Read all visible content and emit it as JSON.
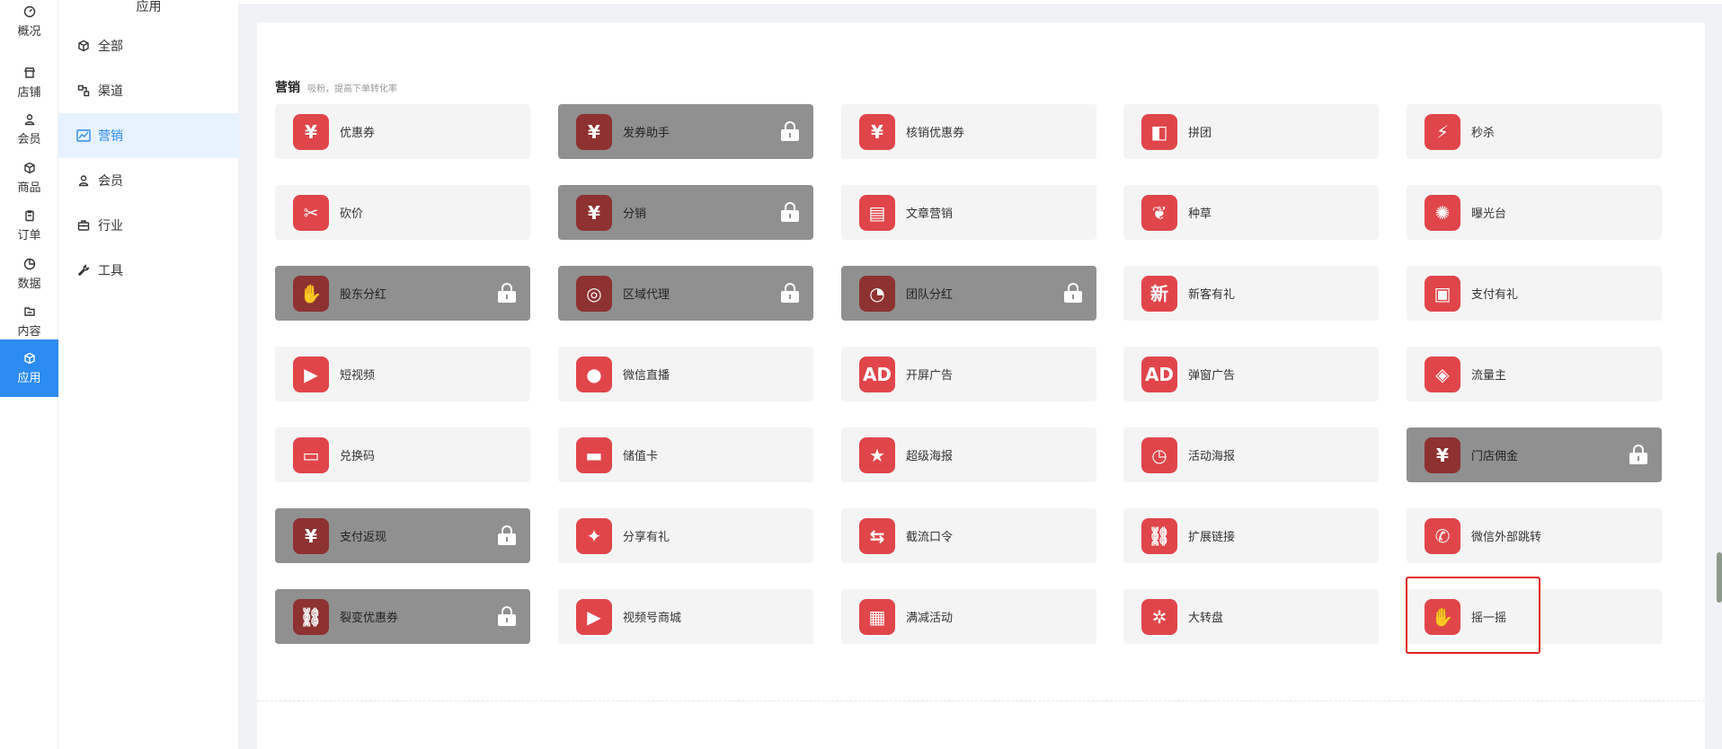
{
  "rail": [
    {
      "label": "概况",
      "icon": "dashboard-icon"
    },
    {
      "label": "店铺",
      "icon": "store-icon"
    },
    {
      "label": "会员",
      "icon": "user-icon"
    },
    {
      "label": "商品",
      "icon": "box-icon"
    },
    {
      "label": "订单",
      "icon": "clipboard-icon"
    },
    {
      "label": "数据",
      "icon": "pie-icon"
    },
    {
      "label": "内容",
      "icon": "folder-icon"
    },
    {
      "label": "应用",
      "icon": "app-icon",
      "active": true
    }
  ],
  "submenu": {
    "title": "应用",
    "items": [
      {
        "label": "全部",
        "icon": "cube-icon"
      },
      {
        "label": "渠道",
        "icon": "channel-icon"
      },
      {
        "label": "营销",
        "icon": "chart-line-icon",
        "active": true
      },
      {
        "label": "会员",
        "icon": "user-icon"
      },
      {
        "label": "行业",
        "icon": "briefcase-icon"
      },
      {
        "label": "工具",
        "icon": "wrench-icon"
      }
    ]
  },
  "section": {
    "title": "营销",
    "subtitle": "吸粉，提高下单转化率"
  },
  "apps": [
    {
      "label": "优惠券",
      "glyph": "¥",
      "icon": "coupon-icon",
      "locked": false
    },
    {
      "label": "发券助手",
      "glyph": "¥",
      "icon": "coupon-helper-icon",
      "locked": true
    },
    {
      "label": "核销优惠券",
      "glyph": "¥",
      "icon": "verify-coupon-icon",
      "locked": false
    },
    {
      "label": "拼团",
      "glyph": "◧",
      "icon": "group-buy-icon",
      "locked": false
    },
    {
      "label": "秒杀",
      "glyph": "⚡",
      "icon": "flash-sale-icon",
      "locked": false
    },
    {
      "label": "砍价",
      "glyph": "✂",
      "icon": "bargain-icon",
      "locked": false
    },
    {
      "label": "分销",
      "glyph": "¥",
      "icon": "distribution-icon",
      "locked": true
    },
    {
      "label": "文章营销",
      "glyph": "▤",
      "icon": "article-icon",
      "locked": false
    },
    {
      "label": "种草",
      "glyph": "❦",
      "icon": "sprout-icon",
      "locked": false
    },
    {
      "label": "曝光台",
      "glyph": "✺",
      "icon": "exposure-icon",
      "locked": false
    },
    {
      "label": "股东分红",
      "glyph": "✋",
      "icon": "shareholder-icon",
      "locked": true
    },
    {
      "label": "区域代理",
      "glyph": "◎",
      "icon": "region-agent-icon",
      "locked": true
    },
    {
      "label": "团队分红",
      "glyph": "◔",
      "icon": "team-dividend-icon",
      "locked": true
    },
    {
      "label": "新客有礼",
      "glyph": "新",
      "icon": "new-customer-icon",
      "locked": false
    },
    {
      "label": "支付有礼",
      "glyph": "▣",
      "icon": "gift-icon",
      "locked": false
    },
    {
      "label": "短视频",
      "glyph": "▶",
      "icon": "video-icon",
      "locked": false
    },
    {
      "label": "微信直播",
      "glyph": "●",
      "icon": "live-icon",
      "locked": false
    },
    {
      "label": "开屏广告",
      "glyph": "AD",
      "icon": "splash-ad-icon",
      "locked": false
    },
    {
      "label": "弹窗广告",
      "glyph": "AD",
      "icon": "popup-ad-icon",
      "locked": false
    },
    {
      "label": "流量主",
      "glyph": "◈",
      "icon": "traffic-icon",
      "locked": false
    },
    {
      "label": "兑换码",
      "glyph": "▭",
      "icon": "redeem-code-icon",
      "locked": false
    },
    {
      "label": "储值卡",
      "glyph": "▬",
      "icon": "stored-card-icon",
      "locked": false
    },
    {
      "label": "超级海报",
      "glyph": "★",
      "icon": "poster-icon",
      "locked": false
    },
    {
      "label": "活动海报",
      "glyph": "◷",
      "icon": "event-poster-icon",
      "locked": false
    },
    {
      "label": "门店佣金",
      "glyph": "¥",
      "icon": "store-commission-icon",
      "locked": true
    },
    {
      "label": "支付返现",
      "glyph": "¥",
      "icon": "cashback-icon",
      "locked": true
    },
    {
      "label": "分享有礼",
      "glyph": "✦",
      "icon": "share-gift-icon",
      "locked": false
    },
    {
      "label": "截流口令",
      "glyph": "⇆",
      "icon": "password-icon",
      "locked": false
    },
    {
      "label": "扩展链接",
      "glyph": "⛓",
      "icon": "link-icon",
      "locked": false
    },
    {
      "label": "微信外部跳转",
      "glyph": "✆",
      "icon": "wechat-jump-icon",
      "locked": false
    },
    {
      "label": "裂变优惠券",
      "glyph": "⛓",
      "icon": "fission-coupon-icon",
      "locked": true
    },
    {
      "label": "视频号商城",
      "glyph": "▶",
      "icon": "video-mall-icon",
      "locked": false
    },
    {
      "label": "满减活动",
      "glyph": "▦",
      "icon": "discount-icon",
      "locked": false
    },
    {
      "label": "大转盘",
      "glyph": "✲",
      "icon": "wheel-icon",
      "locked": false
    },
    {
      "label": "摇一摇",
      "glyph": "✋",
      "icon": "shake-icon",
      "locked": false
    }
  ],
  "colors": {
    "accent": "#2d8cf0",
    "icon_bg": "#e0454a",
    "locked_bg": "#909090",
    "highlight": "#e02020"
  }
}
